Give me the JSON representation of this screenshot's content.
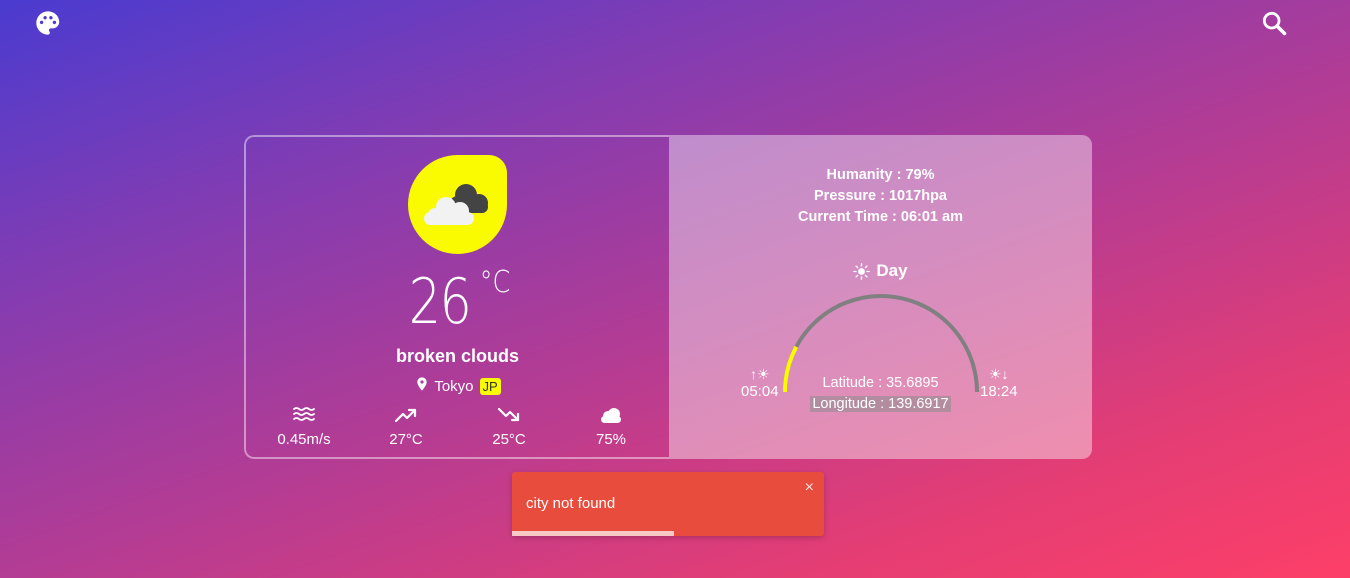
{
  "icons": {
    "palette": "palette-icon",
    "search": "search-icon",
    "weather": "broken-clouds-icon",
    "location": "map-pin-icon",
    "wind": "wind-icon",
    "temp_max": "trending-up-icon",
    "temp_min": "trending-down-icon",
    "clouds": "cloud-icon",
    "sun": "sun-icon",
    "close": "close-icon"
  },
  "weather": {
    "temperature": "26",
    "unit": "°C",
    "description": "broken clouds",
    "city": "Tokyo",
    "country": "JP"
  },
  "stats": {
    "wind": "0.45m/s",
    "temp_max": "27°C",
    "temp_min": "25°C",
    "clouds": "75%"
  },
  "details": {
    "humidity": "Humanity : 79%",
    "pressure": "Pressure : 1017hpa",
    "current_time": "Current Time : 06:01 am",
    "period": "Day",
    "sunrise": "05:04",
    "sunset": "18:24",
    "latitude": "Latitude : 35.6895",
    "longitude": "Longitude : 139.6917",
    "sun_progress": 0.06
  },
  "toast": {
    "message": "city not found",
    "close_label": "×",
    "progress": 0.52
  },
  "colors": {
    "accent_yellow": "#fafa00",
    "toast_red": "#e74c3c",
    "arc_gray": "#808080"
  }
}
